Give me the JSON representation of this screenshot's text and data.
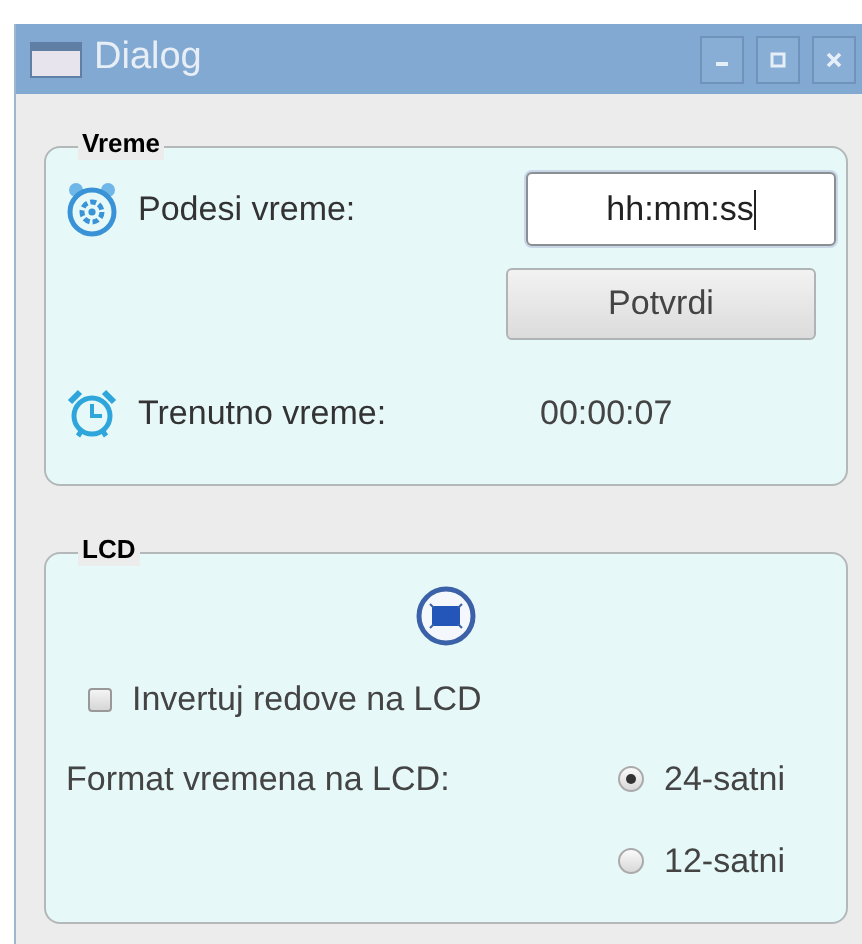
{
  "window": {
    "title": "Dialog"
  },
  "time_group": {
    "title": "Vreme",
    "set_label": "Podesi vreme:",
    "time_input": {
      "value": "hh:mm:ss",
      "focused": true
    },
    "confirm_button": "Potvrdi",
    "current_label": "Trenutno vreme:",
    "current_value": "00:00:07"
  },
  "lcd_group": {
    "title": "LCD",
    "invert_checkbox": {
      "label": "Invertuj redove na LCD",
      "checked": false
    },
    "format_label": "Format vremena na LCD:",
    "format_options": [
      {
        "label": "24-satni",
        "selected": true
      },
      {
        "label": "12-satni",
        "selected": false
      }
    ]
  }
}
